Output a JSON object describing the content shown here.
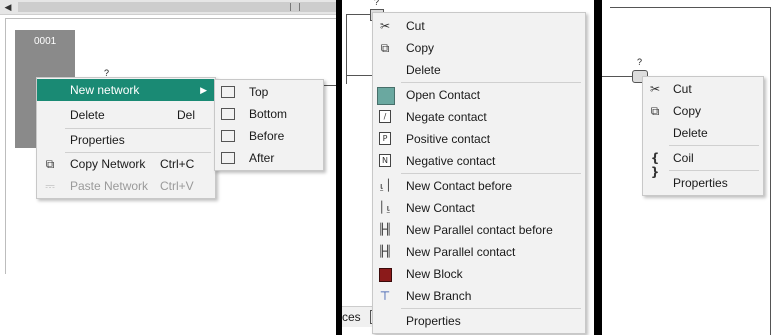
{
  "left_panel": {
    "network_label": "0001",
    "placeholder_mark": "?",
    "network_menu": {
      "items": [
        {
          "label": "New network",
          "shortcut": ""
        },
        {
          "label": "Delete",
          "shortcut": "Del"
        },
        {
          "label": "Properties",
          "shortcut": ""
        },
        {
          "label": "Copy Network",
          "shortcut": "Ctrl+C"
        },
        {
          "label": "Paste Network",
          "shortcut": "Ctrl+V"
        }
      ]
    },
    "submenu": {
      "items": [
        {
          "label": "Top"
        },
        {
          "label": "Bottom"
        },
        {
          "label": "Before"
        },
        {
          "label": "After"
        }
      ]
    }
  },
  "middle_panel": {
    "placeholder_mark": "?",
    "status_fragment": "ces",
    "menu": {
      "items": [
        {
          "label": "Cut",
          "icon": "scissors-icon"
        },
        {
          "label": "Copy",
          "icon": "copy-icon"
        },
        {
          "label": "Delete",
          "icon": ""
        },
        {
          "label": "Open Contact",
          "icon": "open-contact-icon"
        },
        {
          "label": "Negate contact",
          "icon": "negate-contact-icon"
        },
        {
          "label": "Positive contact",
          "icon": "positive-contact-icon"
        },
        {
          "label": "Negative contact",
          "icon": "negative-contact-icon"
        },
        {
          "label": "New Contact before",
          "icon": "new-contact-before-icon"
        },
        {
          "label": "New Contact",
          "icon": "new-contact-icon"
        },
        {
          "label": "New Parallel contact before",
          "icon": "new-parallel-contact-before-icon"
        },
        {
          "label": "New Parallel contact",
          "icon": "new-parallel-contact-icon"
        },
        {
          "label": "New Block",
          "icon": "new-block-icon"
        },
        {
          "label": "New Branch",
          "icon": "new-branch-icon"
        },
        {
          "label": "Properties",
          "icon": ""
        }
      ],
      "glyphs": {
        "positive": "P",
        "negative": "N"
      }
    }
  },
  "right_panel": {
    "placeholder_mark": "?",
    "menu": {
      "items": [
        {
          "label": "Cut"
        },
        {
          "label": "Copy"
        },
        {
          "label": "Delete"
        },
        {
          "label": "Coil",
          "icon_text": "{ }"
        },
        {
          "label": "Properties"
        }
      ]
    }
  },
  "colors": {
    "highlight": "#1a8a74",
    "network_block": "#8a8a8a",
    "divider": "#000000"
  }
}
